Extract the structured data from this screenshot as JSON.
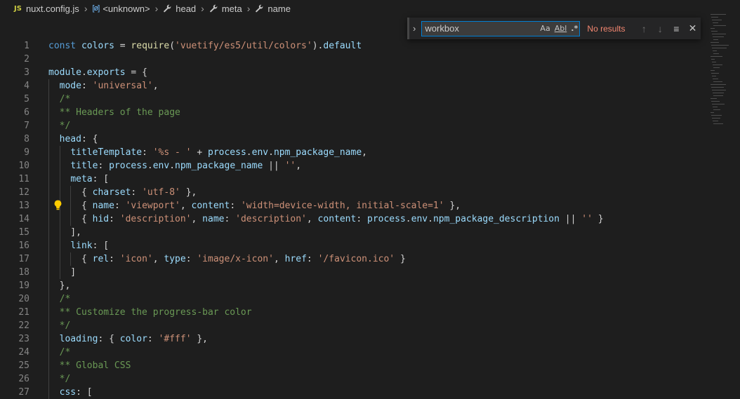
{
  "breadcrumb": {
    "file_icon": "JS",
    "file": "nuxt.config.js",
    "obj_icon": "[ø]",
    "unknown": "<unknown>",
    "head": "head",
    "meta": "meta",
    "name": "name"
  },
  "find": {
    "value": "workbox",
    "match_case": "Aa",
    "whole_word": "Abl",
    "regex": ".*",
    "status": "No results"
  },
  "code_lines": [
    {
      "n": "1",
      "segs": [
        [
          "k",
          "const "
        ],
        [
          "v",
          "colors"
        ],
        [
          "p",
          " = "
        ],
        [
          "f",
          "require"
        ],
        [
          "p",
          "("
        ],
        [
          "s",
          "'vuetify/es5/util/colors'"
        ],
        [
          "p",
          ")."
        ],
        [
          "v",
          "default"
        ]
      ]
    },
    {
      "n": "2",
      "segs": []
    },
    {
      "n": "3",
      "segs": [
        [
          "v",
          "module"
        ],
        [
          "p",
          "."
        ],
        [
          "v",
          "exports"
        ],
        [
          "p",
          " = {"
        ]
      ]
    },
    {
      "n": "4",
      "segs": [
        [
          "p",
          "  "
        ],
        [
          "v",
          "mode"
        ],
        [
          "p",
          ": "
        ],
        [
          "s",
          "'universal'"
        ],
        [
          "p",
          ","
        ]
      ]
    },
    {
      "n": "5",
      "segs": [
        [
          "p",
          "  "
        ],
        [
          "c",
          "/*"
        ]
      ]
    },
    {
      "n": "6",
      "segs": [
        [
          "p",
          "  "
        ],
        [
          "c",
          "** Headers of the page"
        ]
      ]
    },
    {
      "n": "7",
      "segs": [
        [
          "p",
          "  "
        ],
        [
          "c",
          "*/"
        ]
      ]
    },
    {
      "n": "8",
      "segs": [
        [
          "p",
          "  "
        ],
        [
          "v",
          "head"
        ],
        [
          "p",
          ": {"
        ]
      ]
    },
    {
      "n": "9",
      "segs": [
        [
          "p",
          "    "
        ],
        [
          "v",
          "titleTemplate"
        ],
        [
          "p",
          ": "
        ],
        [
          "s",
          "'%s - '"
        ],
        [
          "p",
          " + "
        ],
        [
          "v",
          "process"
        ],
        [
          "p",
          "."
        ],
        [
          "v",
          "env"
        ],
        [
          "p",
          "."
        ],
        [
          "v",
          "npm_package_name"
        ],
        [
          "p",
          ","
        ]
      ]
    },
    {
      "n": "10",
      "segs": [
        [
          "p",
          "    "
        ],
        [
          "v",
          "title"
        ],
        [
          "p",
          ": "
        ],
        [
          "v",
          "process"
        ],
        [
          "p",
          "."
        ],
        [
          "v",
          "env"
        ],
        [
          "p",
          "."
        ],
        [
          "v",
          "npm_package_name"
        ],
        [
          "p",
          " || "
        ],
        [
          "s",
          "''"
        ],
        [
          "p",
          ","
        ]
      ]
    },
    {
      "n": "11",
      "segs": [
        [
          "p",
          "    "
        ],
        [
          "v",
          "meta"
        ],
        [
          "p",
          ": ["
        ]
      ]
    },
    {
      "n": "12",
      "segs": [
        [
          "p",
          "      { "
        ],
        [
          "v",
          "charset"
        ],
        [
          "p",
          ": "
        ],
        [
          "s",
          "'utf-8'"
        ],
        [
          "p",
          " },"
        ]
      ]
    },
    {
      "n": "13",
      "segs": [
        [
          "p",
          "      { "
        ],
        [
          "v",
          "name"
        ],
        [
          "p",
          ": "
        ],
        [
          "s",
          "'viewport'"
        ],
        [
          "p",
          ", "
        ],
        [
          "v",
          "content"
        ],
        [
          "p",
          ": "
        ],
        [
          "s",
          "'width=device-width, initial-scale=1'"
        ],
        [
          "p",
          " },"
        ]
      ]
    },
    {
      "n": "14",
      "segs": [
        [
          "p",
          "      { "
        ],
        [
          "v",
          "hid"
        ],
        [
          "p",
          ": "
        ],
        [
          "s",
          "'description'"
        ],
        [
          "p",
          ", "
        ],
        [
          "v",
          "name"
        ],
        [
          "p",
          ": "
        ],
        [
          "s",
          "'description'"
        ],
        [
          "p",
          ", "
        ],
        [
          "v",
          "content"
        ],
        [
          "p",
          ": "
        ],
        [
          "v",
          "process"
        ],
        [
          "p",
          "."
        ],
        [
          "v",
          "env"
        ],
        [
          "p",
          "."
        ],
        [
          "v",
          "npm_package_description"
        ],
        [
          "p",
          " || "
        ],
        [
          "s",
          "''"
        ],
        [
          "p",
          " }"
        ]
      ]
    },
    {
      "n": "15",
      "segs": [
        [
          "p",
          "    ],"
        ]
      ]
    },
    {
      "n": "16",
      "segs": [
        [
          "p",
          "    "
        ],
        [
          "v",
          "link"
        ],
        [
          "p",
          ": ["
        ]
      ]
    },
    {
      "n": "17",
      "segs": [
        [
          "p",
          "      { "
        ],
        [
          "v",
          "rel"
        ],
        [
          "p",
          ": "
        ],
        [
          "s",
          "'icon'"
        ],
        [
          "p",
          ", "
        ],
        [
          "v",
          "type"
        ],
        [
          "p",
          ": "
        ],
        [
          "s",
          "'image/x-icon'"
        ],
        [
          "p",
          ", "
        ],
        [
          "v",
          "href"
        ],
        [
          "p",
          ": "
        ],
        [
          "s",
          "'/favicon.ico'"
        ],
        [
          "p",
          " }"
        ]
      ]
    },
    {
      "n": "18",
      "segs": [
        [
          "p",
          "    ]"
        ]
      ]
    },
    {
      "n": "19",
      "segs": [
        [
          "p",
          "  },"
        ]
      ]
    },
    {
      "n": "20",
      "segs": [
        [
          "p",
          "  "
        ],
        [
          "c",
          "/*"
        ]
      ]
    },
    {
      "n": "21",
      "segs": [
        [
          "p",
          "  "
        ],
        [
          "c",
          "** Customize the progress-bar color"
        ]
      ]
    },
    {
      "n": "22",
      "segs": [
        [
          "p",
          "  "
        ],
        [
          "c",
          "*/"
        ]
      ]
    },
    {
      "n": "23",
      "segs": [
        [
          "p",
          "  "
        ],
        [
          "v",
          "loading"
        ],
        [
          "p",
          ": { "
        ],
        [
          "v",
          "color"
        ],
        [
          "p",
          ": "
        ],
        [
          "s",
          "'#fff'"
        ],
        [
          "p",
          " },"
        ]
      ]
    },
    {
      "n": "24",
      "segs": [
        [
          "p",
          "  "
        ],
        [
          "c",
          "/*"
        ]
      ]
    },
    {
      "n": "25",
      "segs": [
        [
          "p",
          "  "
        ],
        [
          "c",
          "** Global CSS"
        ]
      ]
    },
    {
      "n": "26",
      "segs": [
        [
          "p",
          "  "
        ],
        [
          "c",
          "*/"
        ]
      ]
    },
    {
      "n": "27",
      "segs": [
        [
          "p",
          "  "
        ],
        [
          "v",
          "css"
        ],
        [
          "p",
          ": ["
        ]
      ]
    }
  ],
  "colors": {
    "background": "#1e1e1e",
    "keyword": "#569cd6",
    "variable": "#9cdcfe",
    "string": "#ce9178",
    "comment": "#6a9955",
    "no_results": "#f48771",
    "focus_border": "#007fd4"
  },
  "icons": {
    "toggle_replace": "chevron-right-icon",
    "prev": "arrow-up-icon",
    "next": "arrow-down-icon",
    "selection": "find-in-selection-icon",
    "close": "close-icon",
    "bulb": "lightbulb-icon",
    "wrench": "wrench-icon"
  }
}
